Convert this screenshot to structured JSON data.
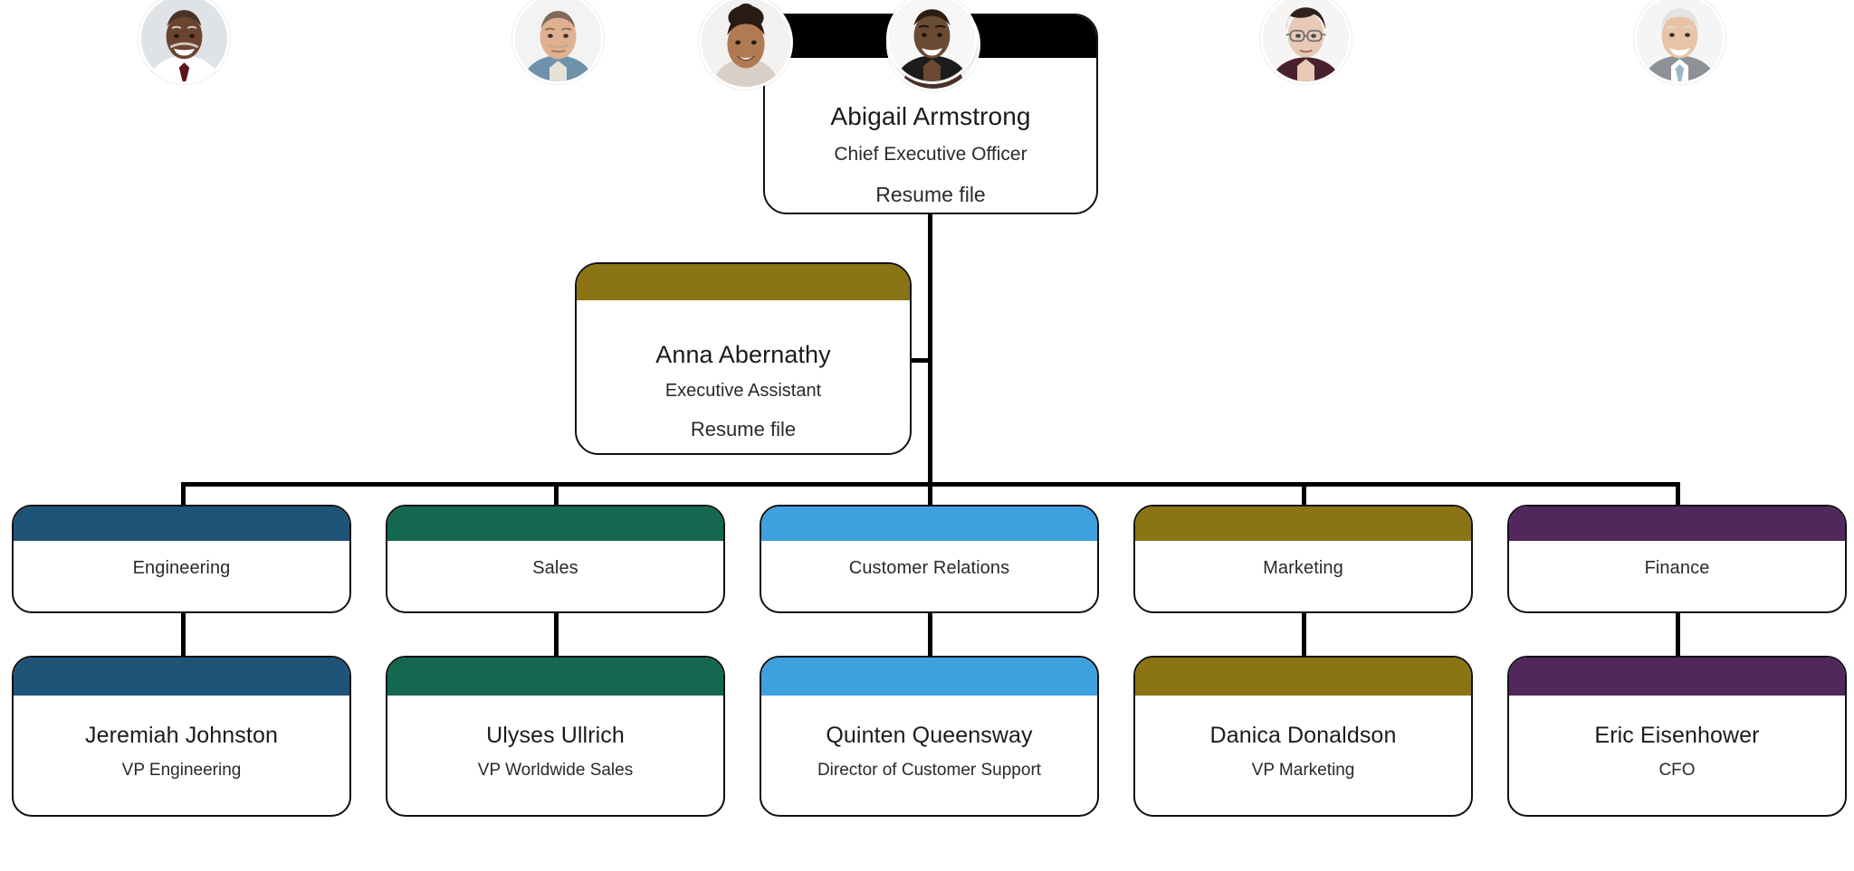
{
  "chart_type": "org-chart",
  "root": {
    "name": "Abigail Armstrong",
    "title": "Chief Executive Officer",
    "resume": "Resume file",
    "band_color": "#000000",
    "avatar": "avatar-abigail-armstrong"
  },
  "assistant": {
    "name": "Anna Abernathy",
    "title": "Executive Assistant",
    "resume": "Resume file",
    "band_color": "#8a7414",
    "avatar": "avatar-anna-abernathy"
  },
  "departments": [
    {
      "label": "Engineering",
      "band_color": "#1f5478"
    },
    {
      "label": "Sales",
      "band_color": "#14684f"
    },
    {
      "label": "Customer Relations",
      "band_color": "#3fa0e0"
    },
    {
      "label": "Marketing",
      "band_color": "#8a7414"
    },
    {
      "label": "Finance",
      "band_color": "#52275c"
    }
  ],
  "people": [
    {
      "name": "Jeremiah Johnston",
      "title": "VP Engineering",
      "band_color": "#1f5478",
      "avatar": "avatar-jeremiah-johnston"
    },
    {
      "name": "Ulyses Ullrich",
      "title": "VP Worldwide Sales",
      "band_color": "#14684f",
      "avatar": "avatar-ulyses-ullrich"
    },
    {
      "name": "Quinten Queensway",
      "title": "Director of Customer Support",
      "band_color": "#3fa0e0",
      "avatar": "avatar-quinten-queensway"
    },
    {
      "name": "Danica Donaldson",
      "title": "VP Marketing",
      "band_color": "#8a7414",
      "avatar": "avatar-danica-donaldson"
    },
    {
      "name": "Eric Eisenhower",
      "title": "CFO",
      "band_color": "#52275c",
      "avatar": "avatar-eric-eisenhower"
    }
  ],
  "theme": {
    "background": "#ffffff",
    "card_border": "#111111",
    "connector": "#000000",
    "text": "#1b1b1b"
  }
}
